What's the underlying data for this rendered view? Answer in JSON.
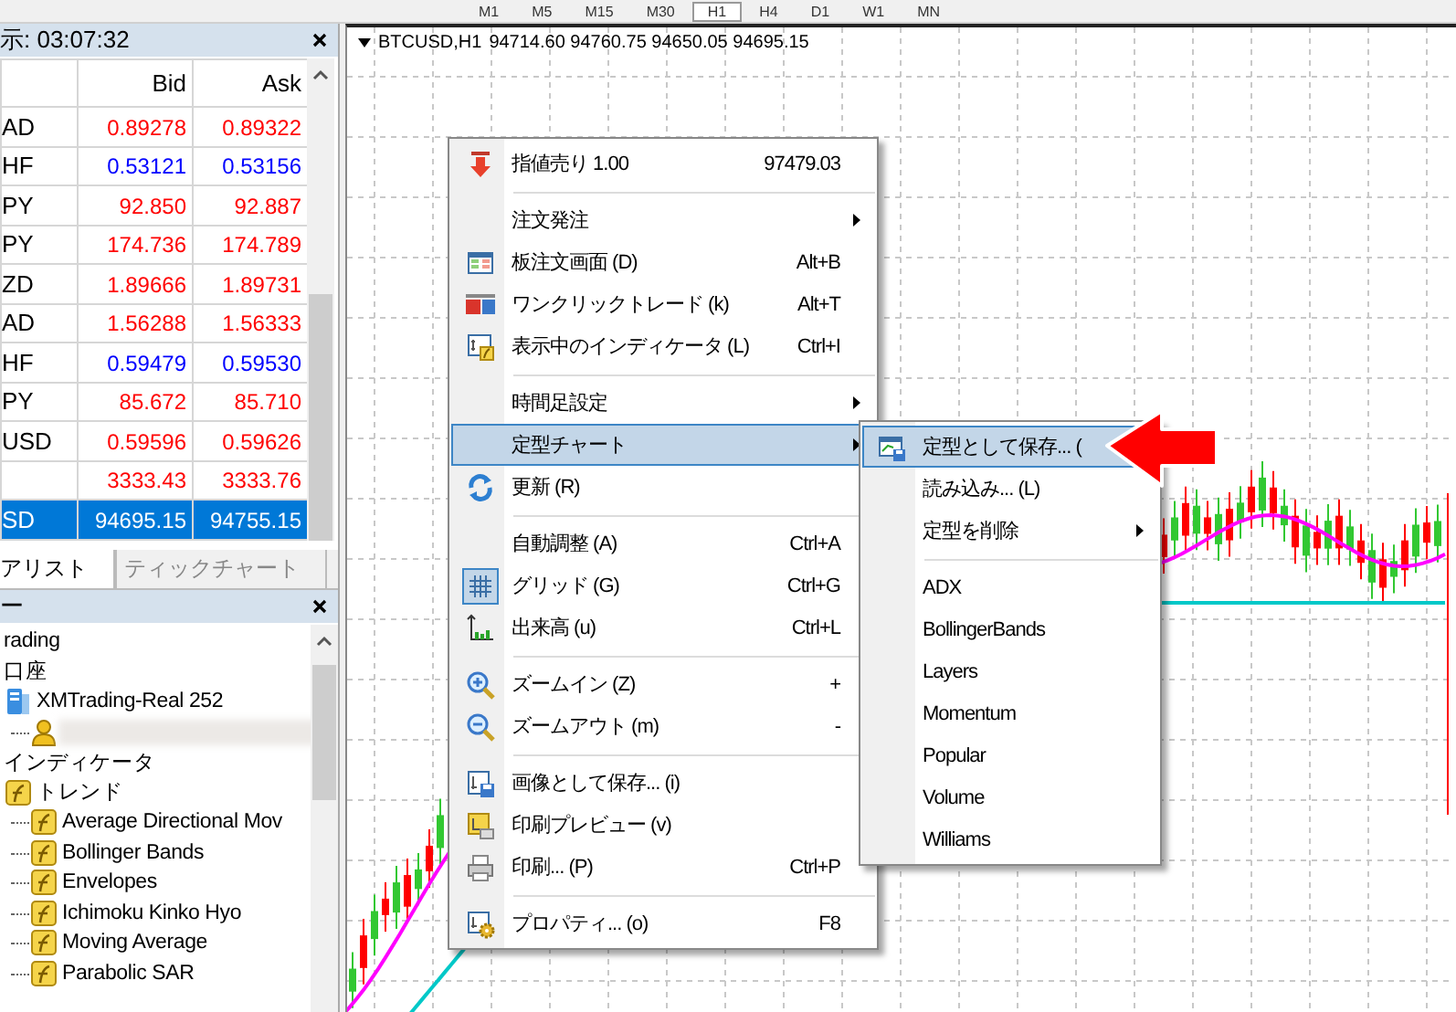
{
  "toolbar": {
    "timeframes": [
      {
        "label": "M1",
        "selected": false
      },
      {
        "label": "M5",
        "selected": false
      },
      {
        "label": "M15",
        "selected": false
      },
      {
        "label": "M30",
        "selected": false
      },
      {
        "label": "H1",
        "selected": true
      },
      {
        "label": "H4",
        "selected": false
      },
      {
        "label": "D1",
        "selected": false
      },
      {
        "label": "W1",
        "selected": false
      },
      {
        "label": "MN",
        "selected": false
      }
    ]
  },
  "market_watch": {
    "title": "示: 03:07:32",
    "columns": [
      "Bid",
      "Ask"
    ],
    "rows": [
      {
        "symbol": "AD",
        "bid": "0.89278",
        "ask": "0.89322",
        "color": "#ff0000",
        "selected": false
      },
      {
        "symbol": "HF",
        "bid": "0.53121",
        "ask": "0.53156",
        "color": "#0000ff",
        "selected": false
      },
      {
        "symbol": "PY",
        "bid": "92.850",
        "ask": "92.887",
        "color": "#ff0000",
        "selected": false
      },
      {
        "symbol": "PY",
        "bid": "174.736",
        "ask": "174.789",
        "color": "#ff0000",
        "selected": false
      },
      {
        "symbol": "ZD",
        "bid": "1.89666",
        "ask": "1.89731",
        "color": "#ff0000",
        "selected": false
      },
      {
        "symbol": "AD",
        "bid": "1.56288",
        "ask": "1.56333",
        "color": "#ff0000",
        "selected": false
      },
      {
        "symbol": "HF",
        "bid": "0.59479",
        "ask": "0.59530",
        "color": "#0000ff",
        "selected": false
      },
      {
        "symbol": "PY",
        "bid": "85.672",
        "ask": "85.710",
        "color": "#ff0000",
        "selected": false
      },
      {
        "symbol": "USD",
        "bid": "0.59596",
        "ask": "0.59626",
        "color": "#ff0000",
        "selected": false
      },
      {
        "bid": "3333.43",
        "ask": "3333.76",
        "color": "#ff0000",
        "selected": false
      },
      {
        "symbol": "SD",
        "bid": "94695.15",
        "ask": "94755.15",
        "selected": true
      }
    ]
  },
  "tabs": [
    {
      "label": "アリスト",
      "selected": true
    },
    {
      "label": "ティックチャート",
      "selected": false
    }
  ],
  "navigator": {
    "title": "ー",
    "tree": [
      {
        "label": "rading"
      },
      {
        "label": "口座",
        "children": [
          {
            "label": "XMTrading-Real 252",
            "kind": "server",
            "children": [
              {
                "kind": "user"
              }
            ]
          }
        ]
      },
      {
        "label": "インディケータ",
        "children": [
          {
            "label": "トレンド",
            "kind": "indicator",
            "children": [
              {
                "label": "Average Directional Mov",
                "kind": "indicator"
              },
              {
                "label": "Bollinger Bands",
                "kind": "indicator"
              },
              {
                "label": "Envelopes",
                "kind": "indicator"
              },
              {
                "label": "Ichimoku Kinko Hyo",
                "kind": "indicator"
              },
              {
                "label": "Moving Average",
                "kind": "indicator"
              },
              {
                "label": "Parabolic SAR",
                "kind": "indicator"
              }
            ]
          }
        ]
      }
    ]
  },
  "chart": {
    "symbol": "BTCUSD,H1",
    "ohlc": "94714.60 94760.75 94650.05 94695.15"
  },
  "context_menu": {
    "items": [
      {
        "kind": "item",
        "label": "指値売り 1.00",
        "shortcut": "97479.03",
        "selected": false,
        "checked": false
      },
      {
        "kind": "separator"
      },
      {
        "kind": "submenu",
        "label": "注文発注",
        "selected": false,
        "checked": false
      },
      {
        "kind": "item",
        "label": "板注文画面 (D)",
        "shortcut": "Alt+B",
        "selected": false,
        "checked": false
      },
      {
        "kind": "item",
        "label": "ワンクリックトレード (k)",
        "shortcut": "Alt+T",
        "selected": false,
        "checked": false
      },
      {
        "kind": "item",
        "label": "表示中のインディケータ (L)",
        "shortcut": "Ctrl+I",
        "selected": false,
        "checked": false
      },
      {
        "kind": "separator"
      },
      {
        "kind": "submenu",
        "label": "時間足設定",
        "selected": false,
        "checked": false
      },
      {
        "kind": "submenu",
        "label": "定型チャート",
        "selected": true,
        "checked": false
      },
      {
        "kind": "item",
        "label": "更新 (R)",
        "selected": false,
        "checked": false
      },
      {
        "kind": "separator"
      },
      {
        "kind": "item",
        "label": "自動調整 (A)",
        "shortcut": "Ctrl+A",
        "selected": false,
        "checked": false
      },
      {
        "kind": "item",
        "label": "グリッド (G)",
        "shortcut": "Ctrl+G",
        "selected": false,
        "checked": true
      },
      {
        "kind": "item",
        "label": "出来高 (u)",
        "shortcut": "Ctrl+L",
        "selected": false,
        "checked": false
      },
      {
        "kind": "separator"
      },
      {
        "kind": "item",
        "label": "ズームイン (Z)",
        "shortcut": "+",
        "selected": false,
        "checked": false
      },
      {
        "kind": "item",
        "label": "ズームアウト (m)",
        "shortcut": "-",
        "selected": false,
        "checked": false
      },
      {
        "kind": "separator"
      },
      {
        "kind": "item",
        "label": "画像として保存... (i)",
        "selected": false,
        "checked": false
      },
      {
        "kind": "item",
        "label": "印刷プレビュー (v)",
        "selected": false,
        "checked": false
      },
      {
        "kind": "item",
        "label": "印刷... (P)",
        "shortcut": "Ctrl+P",
        "selected": false,
        "checked": false
      },
      {
        "kind": "separator"
      },
      {
        "kind": "item",
        "label": "プロパティ... (o)",
        "shortcut": "F8",
        "selected": false,
        "checked": false
      }
    ]
  },
  "submenu": {
    "items": [
      {
        "kind": "item",
        "label": "定型として保存... (",
        "selected": true
      },
      {
        "kind": "item",
        "label": "読み込み... (L)",
        "selected": false
      },
      {
        "kind": "submenu",
        "label": "定型を削除",
        "selected": false
      },
      {
        "kind": "separator"
      },
      {
        "kind": "item",
        "label": "ADX",
        "selected": false
      },
      {
        "kind": "item",
        "label": "BollingerBands",
        "selected": false
      },
      {
        "kind": "item",
        "label": "Layers",
        "selected": false
      },
      {
        "kind": "item",
        "label": "Momentum",
        "selected": false
      },
      {
        "kind": "item",
        "label": "Popular",
        "selected": false
      },
      {
        "kind": "item",
        "label": "Volume",
        "selected": false
      },
      {
        "kind": "item",
        "label": "Williams",
        "selected": false
      }
    ]
  }
}
